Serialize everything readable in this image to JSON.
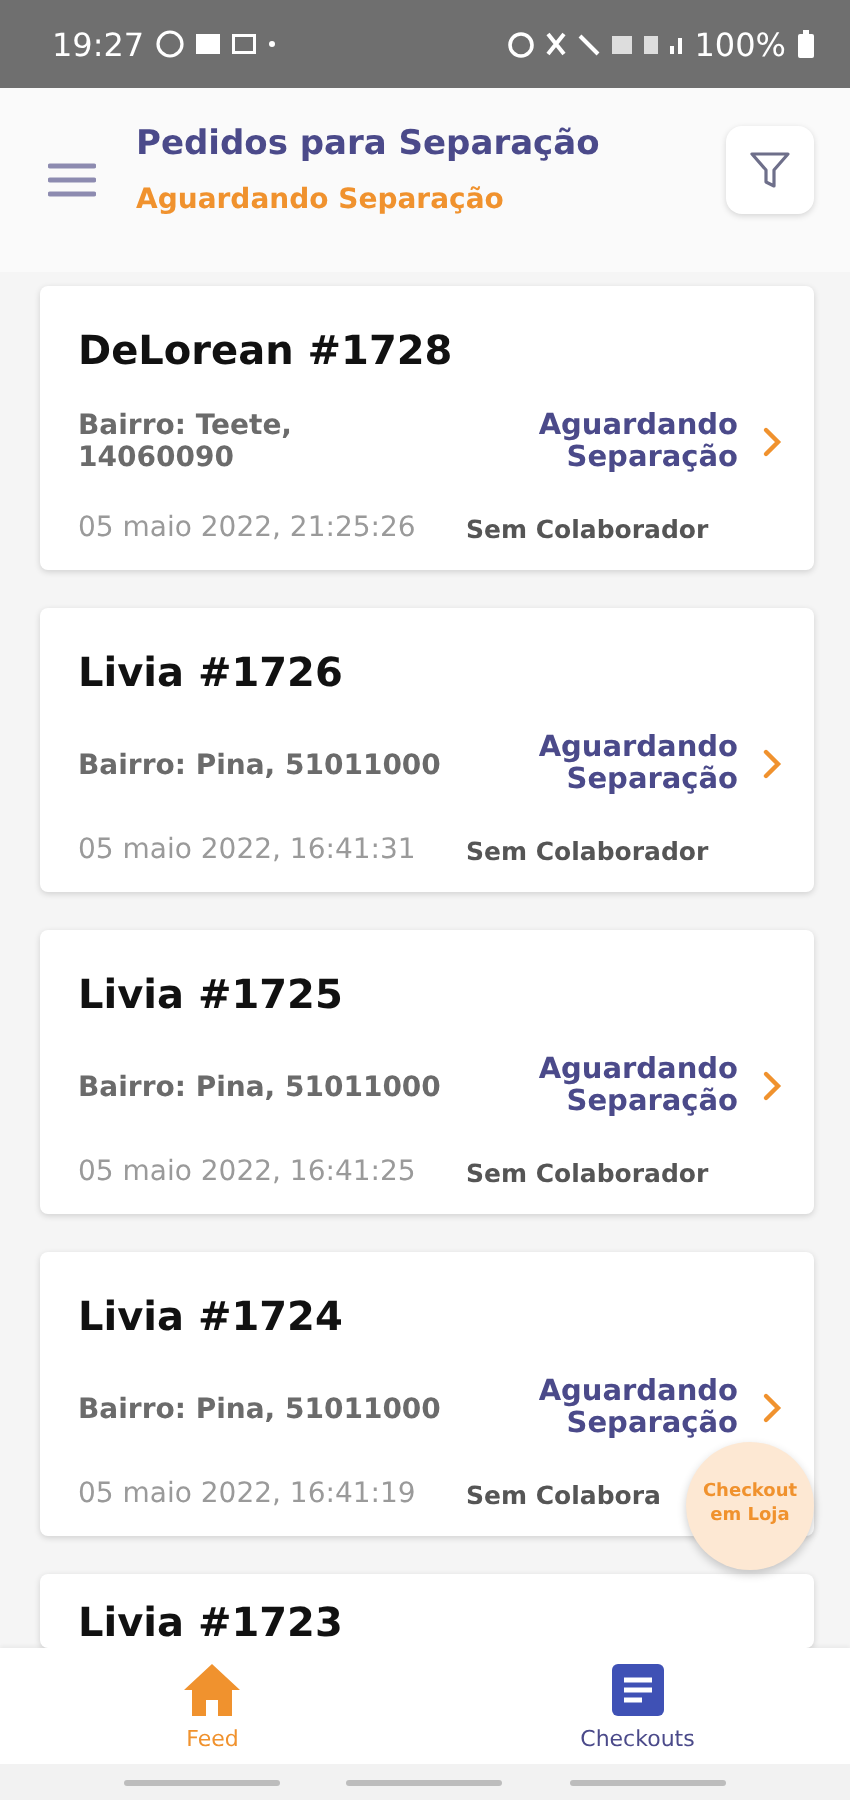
{
  "status_bar": {
    "time": "19:27",
    "battery": "100%"
  },
  "header": {
    "title": "Pedidos para Separação",
    "subtitle": "Aguardando Separação"
  },
  "orders": [
    {
      "title": "DeLorean #1728",
      "address": "Bairro: Teete, 14060090",
      "date": "05 maio 2022, 21:25:26",
      "status": "Aguardando Separação",
      "assignee": "Sem Colaborador"
    },
    {
      "title": "Livia #1726",
      "address": "Bairro: Pina, 51011000",
      "date": "05 maio 2022, 16:41:31",
      "status": "Aguardando Separação",
      "assignee": "Sem Colaborador"
    },
    {
      "title": "Livia #1725",
      "address": "Bairro: Pina, 51011000",
      "date": "05 maio 2022, 16:41:25",
      "status": "Aguardando Separação",
      "assignee": "Sem Colaborador"
    },
    {
      "title": "Livia #1724",
      "address": "Bairro: Pina, 51011000",
      "date": "05 maio 2022, 16:41:19",
      "status": "Aguardando Separação",
      "assignee": "Sem Colabora"
    },
    {
      "title": "Livia #1723"
    }
  ],
  "fab": {
    "label": "Checkout em Loja"
  },
  "nav": [
    {
      "label": "Feed",
      "selected": true,
      "kind": "home"
    },
    {
      "label": "Checkouts",
      "selected": false,
      "kind": "list"
    }
  ]
}
